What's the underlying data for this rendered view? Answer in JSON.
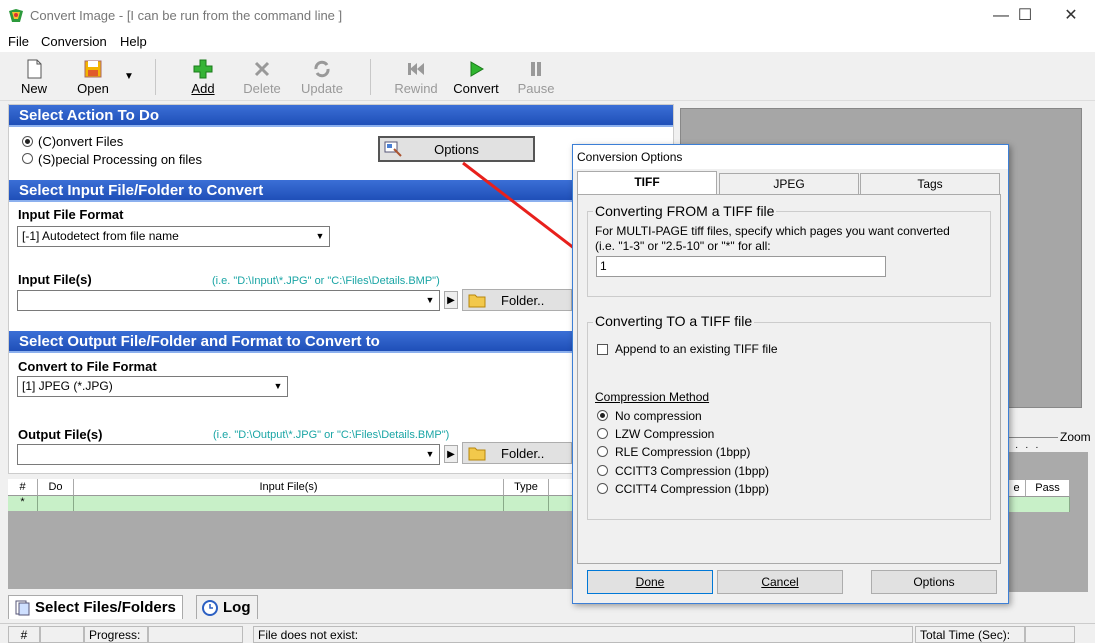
{
  "window": {
    "title": "Convert Image - [I can be run from the command line ]",
    "minimize": "—",
    "maximize": "☐",
    "close": "✕"
  },
  "menu": [
    "File",
    "Conversion",
    "Help"
  ],
  "toolbar": {
    "new": "New",
    "open": "Open",
    "add": "Add",
    "delete": "Delete",
    "update": "Update",
    "rewind": "Rewind",
    "convert": "Convert",
    "pause": "Pause"
  },
  "action": {
    "header": "Select Action To Do",
    "convert_files": "(C)onvert Files",
    "special": "(S)pecial Processing on files",
    "options_button": "Options"
  },
  "input": {
    "header": "Select Input File/Folder to Convert",
    "format_label": "Input File Format",
    "format_value": "[-1] Autodetect from file name",
    "files_label": "Input File(s)",
    "hint": "(i.e. \"D:\\Input\\*.JPG\" or \"C:\\Files\\Details.BMP\")",
    "folder_button": "Folder.."
  },
  "output": {
    "header": "Select Output File/Folder and Format to Convert to",
    "format_label": "Convert to File Format",
    "format_value": "[1] JPEG (*.JPG)",
    "files_label": "Output File(s)",
    "hint": "(i.e. \"D:\\Output\\*.JPG\" or \"C:\\Files\\Details.BMP\")",
    "folder_button": "Folder.."
  },
  "grid": {
    "headers": [
      "#",
      "Do",
      "Input File(s)",
      "Type",
      "e",
      "Pass"
    ],
    "row_marker": "*"
  },
  "right_panel": {
    "zoom_label": "Zoom",
    "dots": "· · ·"
  },
  "bottom_tabs": {
    "files": "Select Files/Folders",
    "log": "Log"
  },
  "status": {
    "hash": "#",
    "progress": "Progress:",
    "message": "File does not exist:",
    "total_time": "Total Time (Sec):"
  },
  "dialog": {
    "title": "Conversion Options",
    "tabs": [
      "TIFF",
      "JPEG",
      "Tags"
    ],
    "from_group": "Converting FROM a TIFF file",
    "from_text1": "For MULTI-PAGE tiff files, specify which pages you want converted",
    "from_text2": "(i.e. \"1-3\" or \"2.5-10\" or \"*\" for all:",
    "pages_value": "1",
    "to_group": "Converting TO a TIFF file",
    "append_label": "Append to an existing TIFF file",
    "compression_label": "Compression Method",
    "compression_options": [
      "No compression",
      "LZW Compression",
      "RLE Compression (1bpp)",
      "CCITT3 Compression (1bpp)",
      "CCITT4 Compression (1bpp)"
    ],
    "done": "Done",
    "cancel": "Cancel",
    "options": "Options"
  },
  "colors": {
    "band": "#1f4fb8",
    "hint": "#1aa5a5",
    "grid_row": "#c8f0c8",
    "arrow": "#e8201c"
  }
}
